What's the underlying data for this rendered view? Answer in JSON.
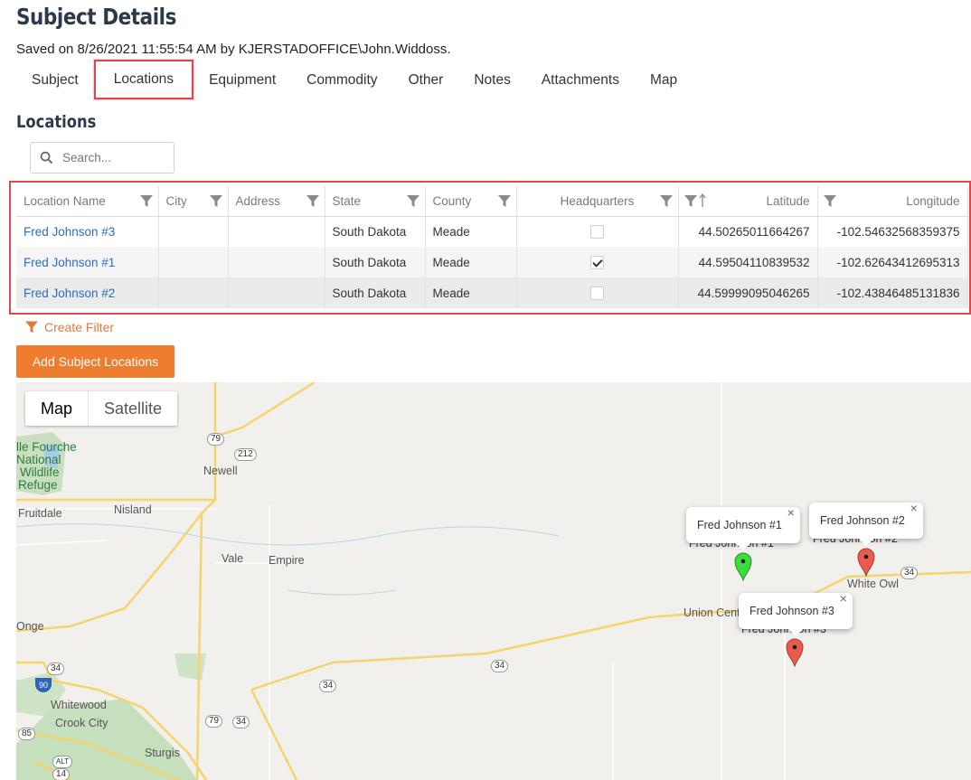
{
  "page": {
    "title": "Subject Details",
    "saved": "Saved on 8/26/2021 11:55:54 AM by KJERSTADOFFICE\\John.Widdoss."
  },
  "tabs": [
    {
      "label": "Subject"
    },
    {
      "label": "Locations"
    },
    {
      "label": "Equipment"
    },
    {
      "label": "Commodity"
    },
    {
      "label": "Other"
    },
    {
      "label": "Notes"
    },
    {
      "label": "Attachments"
    },
    {
      "label": "Map"
    }
  ],
  "locations": {
    "heading": "Locations",
    "search_placeholder": "Search...",
    "columns": [
      "Location Name",
      "City",
      "Address",
      "State",
      "County",
      "Headquarters",
      "Latitude",
      "Longitude"
    ],
    "rows": [
      {
        "name": "Fred Johnson #3",
        "city": "",
        "address": "",
        "state": "South Dakota",
        "county": "Meade",
        "hq": false,
        "lat": "44.50265011664267",
        "lng": "-102.54632568359375"
      },
      {
        "name": "Fred Johnson #1",
        "city": "",
        "address": "",
        "state": "South Dakota",
        "county": "Meade",
        "hq": true,
        "lat": "44.59504110839532",
        "lng": "-102.62643412695313"
      },
      {
        "name": "Fred Johnson #2",
        "city": "",
        "address": "",
        "state": "South Dakota",
        "county": "Meade",
        "hq": false,
        "lat": "44.59999095046265",
        "lng": "-102.43846485131836"
      }
    ],
    "create_filter": "Create Filter",
    "add_button": "Add Subject Locations"
  },
  "map": {
    "type_buttons": {
      "map": "Map",
      "satellite": "Satellite"
    },
    "places": {
      "belle_fourche": "lle Fourche",
      "national": "National",
      "wildlife": "Wildlife",
      "refuge": "Refuge",
      "newell": "Newell",
      "fruitdale": "Fruitdale",
      "nisland": "Nisland",
      "vale": "Vale",
      "empire": "Empire",
      "union_center": "Union Cente",
      "white_owl": "White Owl",
      "onge": "Onge",
      "whitewood": "Whitewood",
      "crook_city": "Crook City",
      "sturgis": "Sturgis"
    },
    "shields": {
      "r79a": "79",
      "r212": "212",
      "r34a": "34",
      "r34b": "34",
      "r34c": "34",
      "r79b": "79",
      "r34d": "34",
      "r34e": "34",
      "r85": "85",
      "r14": "14",
      "i90": "90",
      "alt": "ALT"
    },
    "info_windows": [
      {
        "label": "Fred Johnson #1",
        "under": "Fred Johnson #1",
        "close": "×"
      },
      {
        "label": "Fred Johnson #2",
        "under": "Fred Johnson #2",
        "close": "×"
      },
      {
        "label": "Fred Johnson #3",
        "under": "Fred Johnson #3",
        "close": "×"
      }
    ],
    "marker_colors": {
      "hq": "#3ddc3d",
      "normal": "#ea5b4f"
    }
  },
  "colors": {
    "accent": "#ee7d2f",
    "highlight": "#e0474c",
    "link": "#2a6ebb"
  }
}
